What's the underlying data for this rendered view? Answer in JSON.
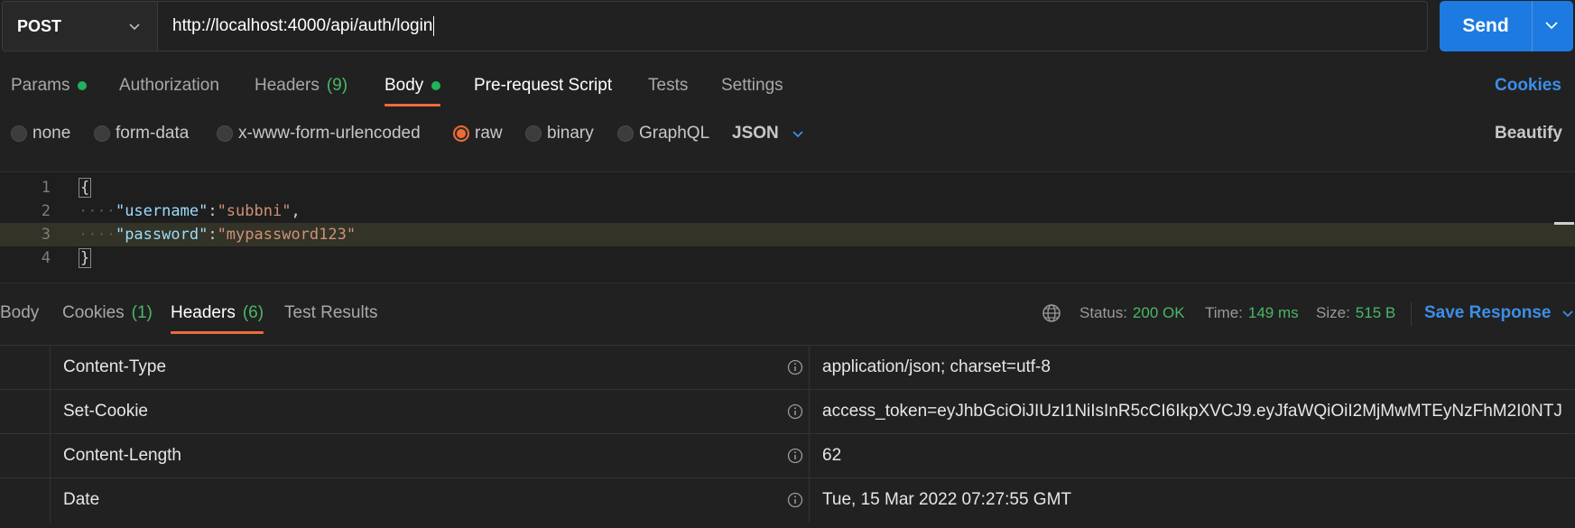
{
  "request": {
    "method": "POST",
    "url": "http://localhost:4000/api/auth/login",
    "send_label": "Send"
  },
  "request_tabs": {
    "params": "Params",
    "authorization": "Authorization",
    "headers": "Headers",
    "headers_count": "(9)",
    "body": "Body",
    "prerequest": "Pre-request Script",
    "tests": "Tests",
    "settings": "Settings",
    "cookies": "Cookies"
  },
  "body_types": {
    "none": "none",
    "form_data": "form-data",
    "urlencoded": "x-www-form-urlencoded",
    "raw": "raw",
    "binary": "binary",
    "graphql": "GraphQL",
    "format": "JSON",
    "beautify": "Beautify"
  },
  "editor": {
    "line_numbers": [
      "1",
      "2",
      "3",
      "4"
    ],
    "open_brace": "{",
    "close_brace": "}",
    "indent": "····",
    "username_key": "\"username\"",
    "username_value": "\"subbni\"",
    "password_key": "\"password\"",
    "password_value": "\"mypassword123\"",
    "colon": ":",
    "comma": ","
  },
  "response_tabs": {
    "body": "Body",
    "cookies": "Cookies",
    "cookies_count": "(1)",
    "headers": "Headers",
    "headers_count": "(6)",
    "test_results": "Test Results"
  },
  "response_status": {
    "status_label": "Status:",
    "status_value": "200 OK",
    "time_label": "Time:",
    "time_value": "149 ms",
    "size_label": "Size:",
    "size_value": "515 B",
    "save_response": "Save Response"
  },
  "response_headers": [
    {
      "key": "Content-Type",
      "value": "application/json; charset=utf-8"
    },
    {
      "key": "Set-Cookie",
      "value": "access_token=eyJhbGciOiJIUzI1NiIsInR5cCI6IkpXVCJ9.eyJfaWQiOiI2MjMwMTEyNzFhM2I0NTJ..."
    },
    {
      "key": "Content-Length",
      "value": "62"
    },
    {
      "key": "Date",
      "value": "Tue, 15 Mar 2022 07:27:55 GMT"
    }
  ],
  "colors": {
    "accent_orange": "#ee6c38",
    "send_blue": "#1d7ae0",
    "link_blue": "#3d8fe8",
    "success_green": "#49b867"
  }
}
